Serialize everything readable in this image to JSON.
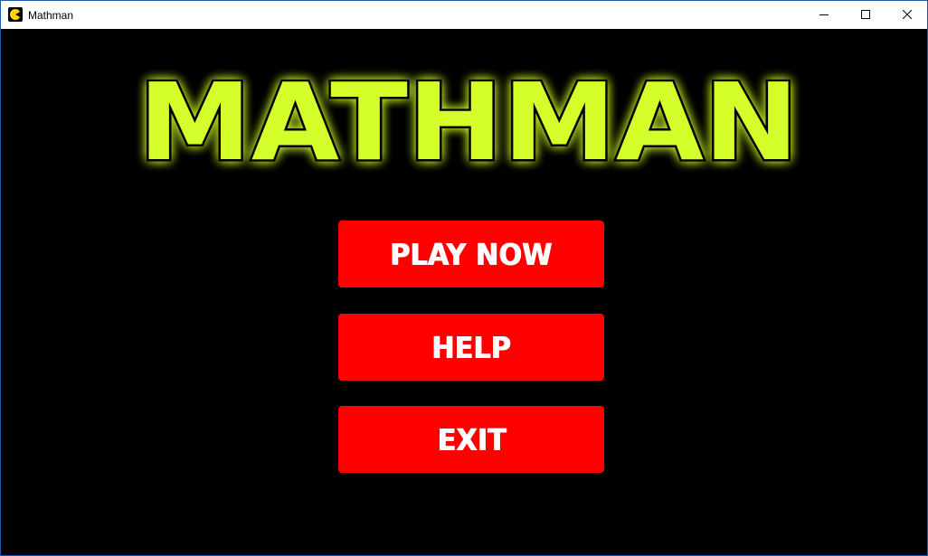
{
  "window": {
    "title": "Mathman",
    "icon": "pacman-icon",
    "controls": [
      "minimize-icon",
      "maximize-icon",
      "close-icon"
    ]
  },
  "game": {
    "logo_text": "MATHMAN",
    "colors": {
      "background": "#000000",
      "logo_fill": "#d4ff2a",
      "logo_glow": "#b8e600",
      "button_bg": "#ff0000",
      "button_text": "#ffffff"
    },
    "menu": {
      "play_label": "PLAY NOW",
      "help_label": "HELP",
      "exit_label": "EXIT"
    }
  }
}
